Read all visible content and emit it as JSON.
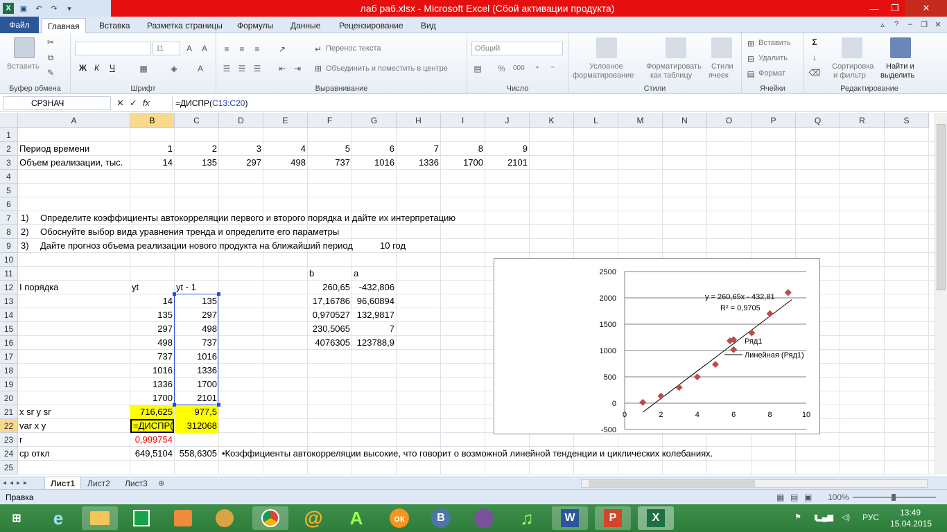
{
  "window": {
    "title": "лаб  ра6.xlsx  -  Microsoft Excel (Сбой активации продукта)",
    "colors": {
      "titlebar": "#e60f0f",
      "accent": "#2b579a",
      "selection": "#f9d98e",
      "highlight": "#ffff00"
    }
  },
  "tabs": {
    "file": "Файл",
    "items": [
      "Главная",
      "Вставка",
      "Разметка страницы",
      "Формулы",
      "Данные",
      "Рецензирование",
      "Вид"
    ]
  },
  "ribbon": {
    "clipboard": {
      "label": "Буфер обмена",
      "paste": "Вставить"
    },
    "font": {
      "label": "Шрифт",
      "size": "11",
      "bold": "Ж",
      "italic": "К",
      "underline": "Ч"
    },
    "alignment": {
      "label": "Выравнивание",
      "wrap": "Перенос текста",
      "merge": "Объединить и поместить в центре"
    },
    "number": {
      "label": "Число",
      "format": "Общий",
      "percent": "%",
      "thousands": "000"
    },
    "styles": {
      "label": "Стили",
      "conditional": [
        "Условное",
        "форматирование"
      ],
      "table": [
        "Форматировать",
        "как таблицу"
      ],
      "cellstyles": [
        "Стили",
        "ячеек"
      ]
    },
    "cells": {
      "label": "Ячейки",
      "insert": "Вставить",
      "delete": "Удалить",
      "format": "Формат"
    },
    "editing": {
      "label": "Редактирование",
      "sort": [
        "Сортировка",
        "и фильтр"
      ],
      "find": [
        "Найти и",
        "выделить"
      ]
    }
  },
  "formula_bar": {
    "name_box": "СРЗНАЧ",
    "formula_prefix": "=ДИСПР(",
    "formula_ref": "C13:C20",
    "formula_suffix": ")"
  },
  "columns": [
    "A",
    "B",
    "C",
    "D",
    "E",
    "F",
    "G",
    "H",
    "I",
    "J",
    "K",
    "L",
    "M",
    "N",
    "O",
    "P",
    "Q",
    "R",
    "S"
  ],
  "rows": [
    "1",
    "2",
    "3",
    "4",
    "5",
    "6",
    "7",
    "8",
    "9",
    "10",
    "11",
    "12",
    "13",
    "14",
    "15",
    "16",
    "17",
    "18",
    "19",
    "20",
    "21",
    "22",
    "23",
    "24",
    "25"
  ],
  "sheet": {
    "row2_label": "Период времени",
    "row2_values": [
      "1",
      "2",
      "3",
      "4",
      "5",
      "6",
      "7",
      "8",
      "9"
    ],
    "row3_label": "Объем реализации, тыс.",
    "row3_values": [
      "14",
      "135",
      "297",
      "498",
      "737",
      "1016",
      "1336",
      "1700",
      "2101"
    ],
    "tasks": [
      {
        "num": "1)",
        "text": "Определите коэффициенты автокорреляции первого и второго порядка и дайте их интерпретацию"
      },
      {
        "num": "2)",
        "text": "Обоснуйте выбор вида уравнения тренда и определите его параметры"
      },
      {
        "num": "3)",
        "text": "Дайте прогноз объема реализации нового продукта на ближайший период"
      }
    ],
    "forecast": "10 год",
    "hdr_b": "b",
    "hdr_a": "a",
    "row12_a": "I порядка",
    "row12_b": "yt",
    "row12_c": "yt - 1",
    "yt": [
      "14",
      "135",
      "297",
      "498",
      "737",
      "1016",
      "1336",
      "1700"
    ],
    "yt1": [
      "135",
      "297",
      "498",
      "737",
      "1016",
      "1336",
      "1700",
      "2101"
    ],
    "linest_f": [
      "260,65",
      "17,16786",
      "0,970527",
      "230,5065",
      "4076305"
    ],
    "linest_g": [
      "-432,806",
      "96,60894",
      "132,9817",
      "7",
      "123788,9"
    ],
    "row21_a": "x sr      y sr",
    "row21_b": "716,625",
    "row21_c": "977,5",
    "row22_a": "var x      y",
    "row22_b": "=ДИСПР(С",
    "row22_c": "312068",
    "row23_a": "r",
    "row23_b": "0,999754",
    "row24_a": "ср откл",
    "row24_b": "649,5104",
    "row24_c": "558,6305",
    "row24_note": "•Коэффициенты автокорреляции высокие, что говорит о возможной линейной тенденции и циклических колебаниях."
  },
  "chart_data": {
    "type": "scatter",
    "x": [
      1,
      2,
      3,
      4,
      5,
      6,
      6,
      7,
      8,
      9
    ],
    "y": [
      14,
      135,
      297,
      498,
      737,
      1016,
      1205,
      1336,
      1700,
      2101
    ],
    "series": [
      {
        "name": "Ряд1"
      },
      {
        "name": "Линейная (Ряд1)"
      }
    ],
    "trendline": {
      "slope": 260.65,
      "intercept": -432.81,
      "equation": "y = 260,65x - 432,81",
      "r2": "R² = 0,9705"
    },
    "xlim": [
      0,
      10
    ],
    "ylim": [
      -500,
      2500
    ],
    "xticks": [
      "0",
      "2",
      "4",
      "6",
      "8",
      "10"
    ],
    "yticks": [
      "2500",
      "2000",
      "1500",
      "1000",
      "500",
      "0",
      "-500"
    ],
    "grid": true,
    "legend": "right",
    "marker_color": "#be4b48"
  },
  "sheet_tabs": [
    "Лист1",
    "Лист2",
    "Лист3"
  ],
  "status": {
    "mode": "Правка",
    "zoom": "100%"
  },
  "taskbar": {
    "lang": "РУС",
    "time": "13:49",
    "date": "15.04.2015"
  }
}
